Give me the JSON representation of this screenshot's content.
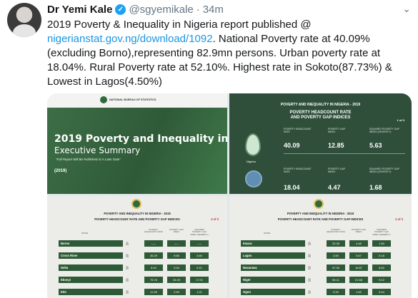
{
  "tweet": {
    "author_name": "Dr Yemi Kale",
    "handle": "@sgyemikale",
    "separator": "·",
    "time": "34m",
    "text_before_link": "2019 Poverty & Inequality in Nigeria report published @ ",
    "link": "nigerianstat.gov.ng/download/1092",
    "text_after_link": ".  National Poverty rate at 40.09% (excluding Borno),representing 82.9mn persons. Urban poverty rate at 18.04%. Rural Poverty rate at 52.10%. Highest rate in Sokoto(87.73%) & Lowest in Lagos(4.50%)",
    "verified_icon": "verified-check-icon",
    "menu_icon": "chevron-down-icon"
  },
  "media": {
    "tile1": {
      "logo_text": "NATIONAL BUREAU OF STATISTICS",
      "title": "2019 Poverty and Inequality in Nigeria:",
      "subtitle": "Executive Summary",
      "note": "\"Full Report Will Be Published At A Later Date\"",
      "year": "(2019)"
    },
    "tile2": {
      "header": "POVERTY AND INEQUALITY IN NIGERIA - 2019",
      "subheader_line1": "POVERTY HEADCOUNT RATE",
      "subheader_line2": "AND POVERTY GAP INDICES",
      "page": "1 of 3",
      "map_label": "Nigeria",
      "labels": [
        "POVERTY HEADCOUNT RATE",
        "POVERTY GAP INDEX",
        "SQUARED POVERTY GAP INDEX (SEVERITY)"
      ],
      "row1": [
        "40.09",
        "12.85",
        "5.63"
      ],
      "row2": [
        "18.04",
        "4.47",
        "1.68"
      ]
    },
    "table_header": {
      "title": "POVERTY AND INEQUALITY IN NIGERIA - 2019",
      "subtitle": "POVERTY HEADCOUNT RATE AND POVERTY GAP INDICES",
      "page": "2 of 3",
      "state_col": "STATE",
      "col1": "POVERTY HEADCOUNT RATE",
      "col2": "POVERTY GAP INDEX",
      "col3": "SQUARED POVERTY GAP INDEX (SEVERITY)"
    },
    "tile3_rows": [
      {
        "state": "Borno",
        "v1": "-----",
        "v2": "-----",
        "v3": "-----"
      },
      {
        "state": "Cross River",
        "v1": "36.29",
        "v2": "9.66",
        "v3": "3.60"
      },
      {
        "state": "Delta",
        "v1": "6.02",
        "v2": "0.94",
        "v3": "0.21"
      },
      {
        "state": "Ebonyi",
        "v1": "79.76",
        "v2": "34.09",
        "v3": "17.01"
      },
      {
        "state": "Edo",
        "v1": "11.99",
        "v2": "2.90",
        "v3": "1.01"
      }
    ],
    "tile4_rows": [
      {
        "state": "Kwara",
        "v1": "20.35",
        "v2": "4.45",
        "v3": "1.50"
      },
      {
        "state": "Lagos",
        "v1": "4.50",
        "v2": "0.67",
        "v3": "0.18"
      },
      {
        "state": "Nasarawa",
        "v1": "57.30",
        "v2": "16.87",
        "v3": "6.62"
      },
      {
        "state": "Niger",
        "v1": "66.11",
        "v2": "21.68",
        "v3": "9.12"
      },
      {
        "state": "Ogun",
        "v1": "9.32",
        "v2": "1.62",
        "v3": "0.44"
      }
    ]
  }
}
